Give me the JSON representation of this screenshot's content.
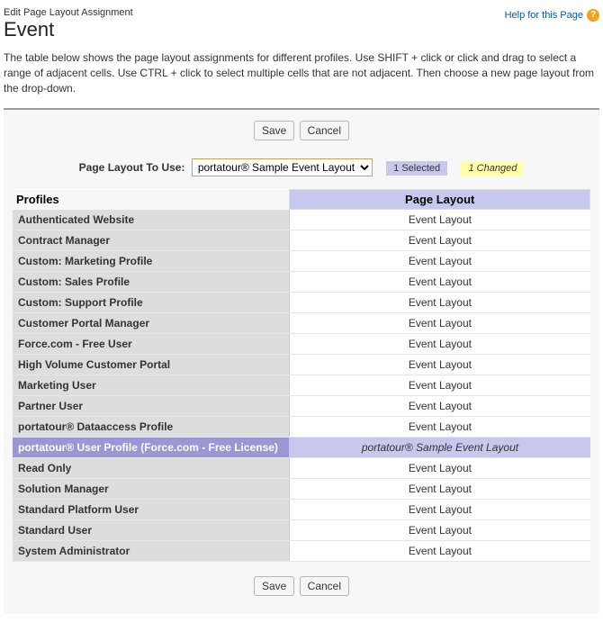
{
  "header": {
    "subtitle": "Edit Page Layout Assignment",
    "title": "Event",
    "help_text": "Help for this Page",
    "help_glyph": "?"
  },
  "intro": "The table below shows the page layout assignments for different profiles. Use SHIFT + click or click and drag to select a range of adjacent cells. Use CTRL + click to select multiple cells that are not adjacent. Then choose a new page layout from the drop-down.",
  "buttons": {
    "save": "Save",
    "cancel": "Cancel"
  },
  "controls": {
    "label": "Page Layout To Use:",
    "selected_value": "portatour® Sample Event Layout",
    "badge_selected": "1 Selected",
    "badge_changed": "1 Changed"
  },
  "table": {
    "col_profiles": "Profiles",
    "col_layout": "Page Layout",
    "rows": [
      {
        "profile": "Authenticated Website",
        "layout": "Event Layout",
        "selected": false
      },
      {
        "profile": "Contract Manager",
        "layout": "Event Layout",
        "selected": false
      },
      {
        "profile": "Custom: Marketing Profile",
        "layout": "Event Layout",
        "selected": false
      },
      {
        "profile": "Custom: Sales Profile",
        "layout": "Event Layout",
        "selected": false
      },
      {
        "profile": "Custom: Support Profile",
        "layout": "Event Layout",
        "selected": false
      },
      {
        "profile": "Customer Portal Manager",
        "layout": "Event Layout",
        "selected": false
      },
      {
        "profile": "Force.com - Free User",
        "layout": "Event Layout",
        "selected": false
      },
      {
        "profile": "High Volume Customer Portal",
        "layout": "Event Layout",
        "selected": false
      },
      {
        "profile": "Marketing User",
        "layout": "Event Layout",
        "selected": false
      },
      {
        "profile": "Partner User",
        "layout": "Event Layout",
        "selected": false
      },
      {
        "profile": "portatour® Dataaccess Profile",
        "layout": "Event Layout",
        "selected": false
      },
      {
        "profile": "portatour® User Profile (Force.com - Free License)",
        "layout": "portatour® Sample Event Layout",
        "selected": true
      },
      {
        "profile": "Read Only",
        "layout": "Event Layout",
        "selected": false
      },
      {
        "profile": "Solution Manager",
        "layout": "Event Layout",
        "selected": false
      },
      {
        "profile": "Standard Platform User",
        "layout": "Event Layout",
        "selected": false
      },
      {
        "profile": "Standard User",
        "layout": "Event Layout",
        "selected": false
      },
      {
        "profile": "System Administrator",
        "layout": "Event Layout",
        "selected": false
      }
    ]
  }
}
